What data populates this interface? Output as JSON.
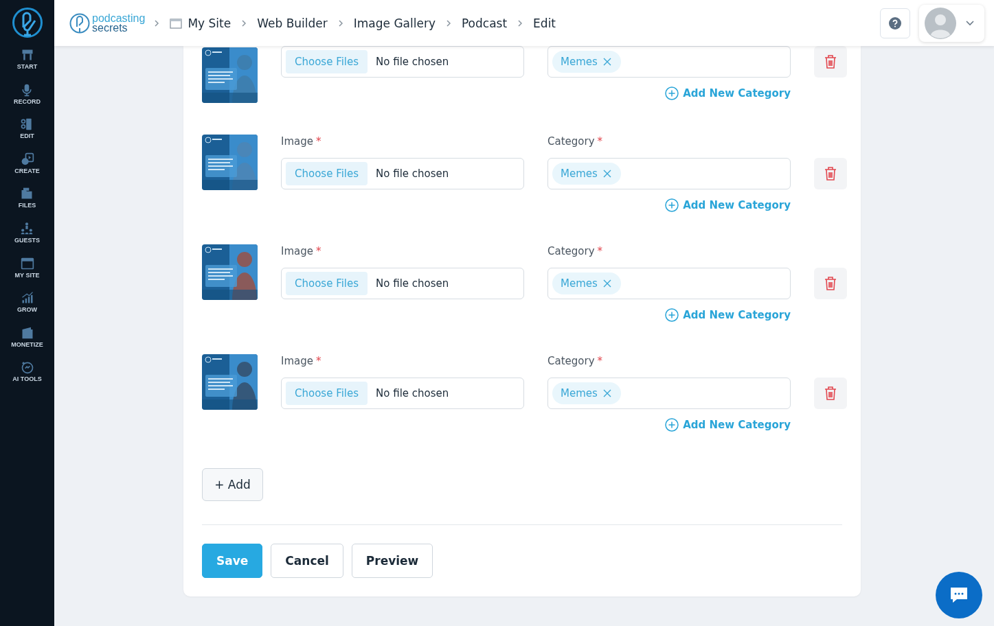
{
  "sidebar": {
    "items": [
      {
        "label": "START"
      },
      {
        "label": "RECORD"
      },
      {
        "label": "EDIT"
      },
      {
        "label": "CREATE"
      },
      {
        "label": "FILES"
      },
      {
        "label": "GUESTS"
      },
      {
        "label": "MY SITE"
      },
      {
        "label": "GROW"
      },
      {
        "label": "MONETIZE"
      },
      {
        "label": "AI TOOLS"
      }
    ]
  },
  "header": {
    "logo": {
      "line_1": "podcasting",
      "line_2": "secrets"
    },
    "breadcrumbs": [
      "My Site",
      "Web Builder",
      "Image Gallery",
      "Podcast",
      "Edit"
    ]
  },
  "rows": [
    {
      "file_button": "Choose Files",
      "file_status": "No file chosen",
      "tags": [
        "Memes"
      ],
      "add_category": "Add New Category"
    },
    {
      "image_label": "Image",
      "image_required": "*",
      "category_label": "Category",
      "category_required": "*",
      "file_button": "Choose Files",
      "file_status": "No file chosen",
      "tags": [
        "Memes"
      ],
      "add_category": "Add New Category"
    },
    {
      "image_label": "Image",
      "image_required": "*",
      "category_label": "Category",
      "category_required": "*",
      "file_button": "Choose Files",
      "file_status": "No file chosen",
      "tags": [
        "Memes"
      ],
      "add_category": "Add New Category"
    },
    {
      "image_label": "Image",
      "image_required": "*",
      "category_label": "Category",
      "category_required": "*",
      "file_button": "Choose Files",
      "file_status": "No file chosen",
      "tags": [
        "Memes"
      ],
      "add_category": "Add New Category"
    }
  ],
  "add_button": "+ Add",
  "actions": [
    {
      "label": "Save",
      "kind": "primary"
    },
    {
      "label": "Cancel",
      "kind": "secondary"
    },
    {
      "label": "Preview",
      "kind": "secondary"
    }
  ]
}
